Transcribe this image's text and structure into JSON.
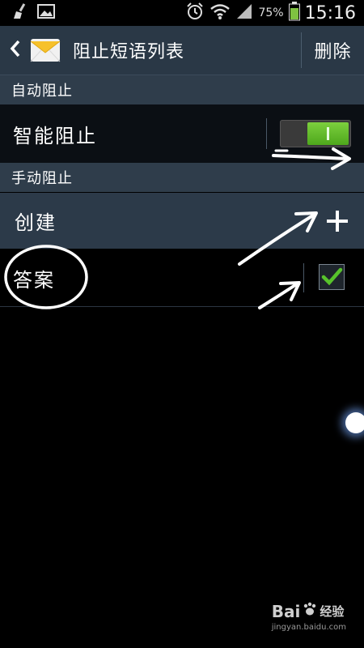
{
  "status_bar": {
    "battery_percent": "75%",
    "time": "15:16",
    "icons": [
      "broom-icon",
      "image-icon",
      "alarm-icon",
      "wifi-icon",
      "signal-icon",
      "battery-icon"
    ]
  },
  "action_bar": {
    "title": "阻止短语列表",
    "delete_label": "删除",
    "app_icon": "message-envelope-icon"
  },
  "sections": {
    "auto_block": {
      "header": "自动阻止",
      "smart_block_label": "智能阻止",
      "smart_block_enabled": true
    },
    "manual_block": {
      "header": "手动阻止",
      "create_label": "创建",
      "phrases": [
        {
          "text": "答案",
          "checked": true
        }
      ]
    }
  },
  "colors": {
    "action_bar_bg": "#2a3846",
    "section_header_bg": "#2f3d4b",
    "toggle_on": "#5dbb2a",
    "check_green": "#57c22b"
  },
  "watermark": {
    "logo_text": "Bai",
    "logo_suffix": "经验",
    "url": "jingyan.baidu.com"
  }
}
